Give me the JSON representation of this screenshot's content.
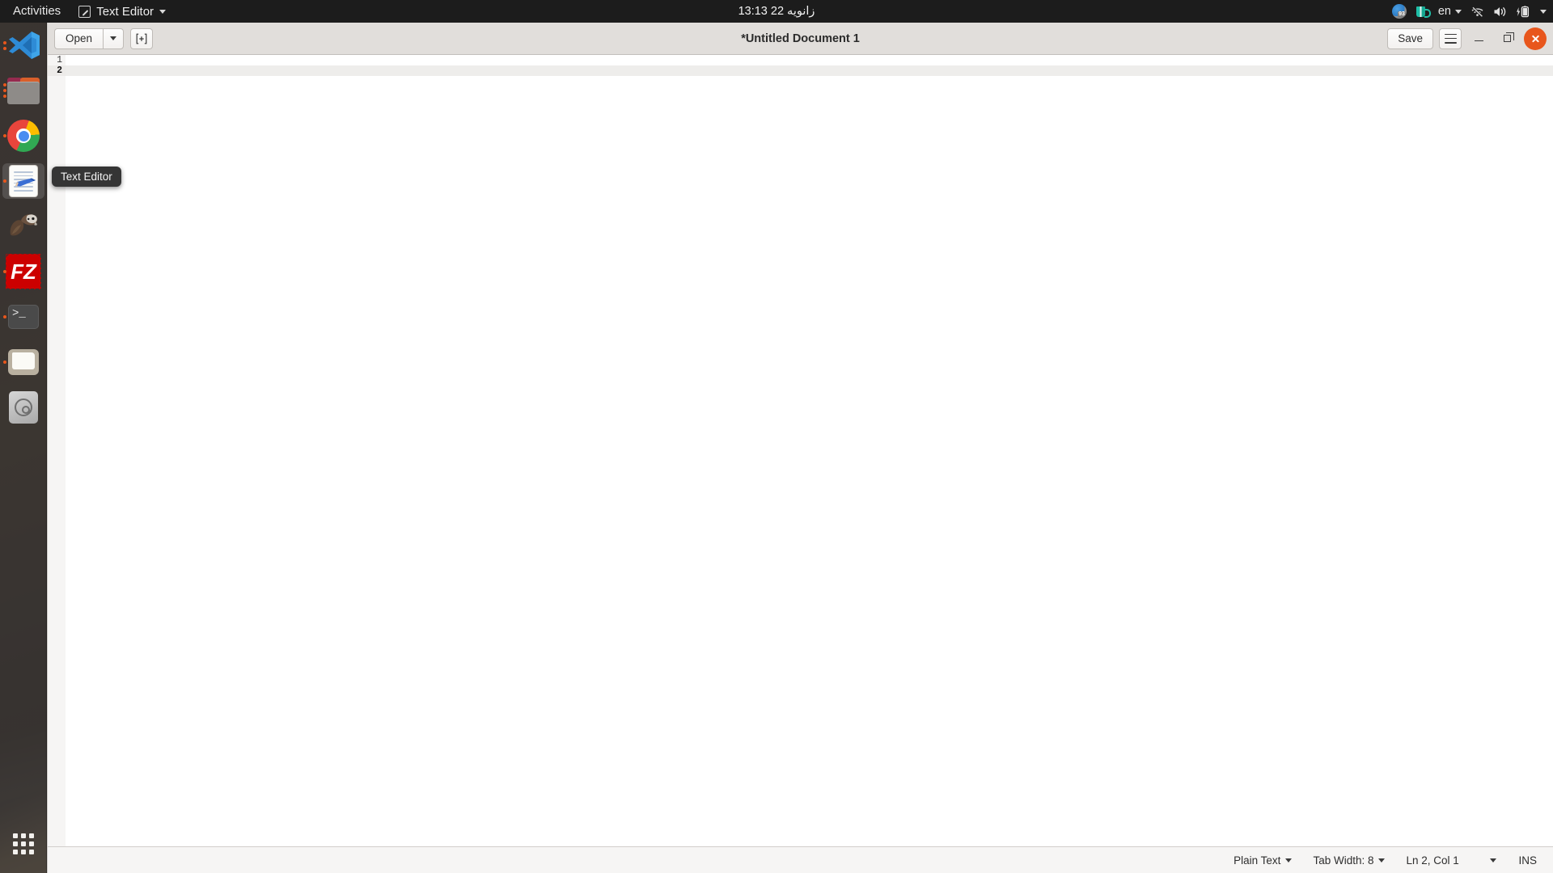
{
  "topbar": {
    "activities": "Activities",
    "app_menu": {
      "label": "Text Editor",
      "icon": "text-editor-icon"
    },
    "clock": "13:13  22 زانویه",
    "tray": {
      "disk_usage_badge": "93",
      "disk_icon": "disk-usage-icon",
      "mug_icon": "coffee-mug-icon",
      "language": "en",
      "network_icon": "wifi-disconnected-icon",
      "volume_icon": "volume-speaker-icon",
      "battery_icon": "battery-charging-icon",
      "menu_icon": "chevron-down-icon"
    }
  },
  "dock": {
    "items": [
      {
        "name": "visual-studio-code",
        "icon": "vscode-icon",
        "dots": 2,
        "active": false
      },
      {
        "name": "files-nautilus",
        "icon": "folder-purple-icon",
        "dots": 3,
        "active": false
      },
      {
        "name": "google-chrome",
        "icon": "chrome-icon",
        "dots": 1,
        "active": false
      },
      {
        "name": "text-editor",
        "icon": "gedit-icon",
        "dots": 1,
        "active": true
      },
      {
        "name": "dbeaver",
        "icon": "beaver-icon",
        "dots": 0,
        "active": false
      },
      {
        "name": "filezilla",
        "icon": "filezilla-icon",
        "dots": 1,
        "active": false
      },
      {
        "name": "terminal",
        "icon": "terminal-icon",
        "dots": 1,
        "active": false
      },
      {
        "name": "file-manager",
        "icon": "folder-white-icon",
        "dots": 1,
        "active": false
      },
      {
        "name": "install-media",
        "icon": "disk-install-icon",
        "dots": 0,
        "active": false
      }
    ],
    "show_applications": "show-applications-grid-icon"
  },
  "window": {
    "title": "*Untitled Document 1",
    "toolbar": {
      "open_label": "Open",
      "open_dropdown_icon": "chevron-down-icon",
      "new_document_icon": "new-document-icon",
      "save_label": "Save",
      "menu_icon": "hamburger-menu-icon"
    },
    "controls": {
      "minimize_icon": "minimize-icon",
      "maximize_icon": "maximize-icon",
      "close_icon": "close-icon",
      "close_color": "#e8561c"
    }
  },
  "editor": {
    "lines": [
      {
        "number": "1",
        "text": "",
        "current": false
      },
      {
        "number": "2",
        "text": "",
        "current": true
      }
    ],
    "current_line_highlight": "#eeedeb"
  },
  "statusbar": {
    "language": "Plain Text",
    "language_dropdown_icon": "chevron-down-icon",
    "tab_width": "Tab Width: 8",
    "tab_width_dropdown_icon": "chevron-down-icon",
    "cursor_position": "Ln 2, Col 1",
    "cursor_dropdown_icon": "chevron-down-icon",
    "insert_mode": "INS"
  },
  "tooltip": {
    "text": "Text Editor"
  }
}
